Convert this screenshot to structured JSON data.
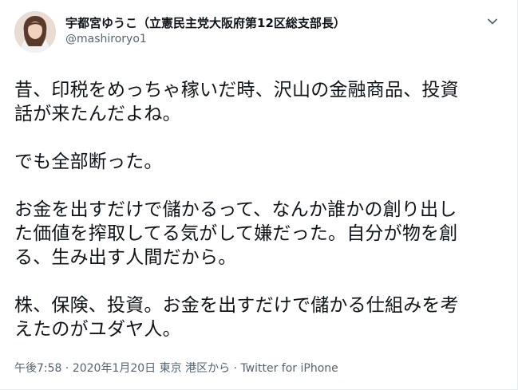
{
  "author": {
    "display_name": "宇都宮ゆうこ（立憲民主党大阪府第12区総支部長）",
    "handle": "@mashiroryo1"
  },
  "icons": {
    "avatar": "profile-photo",
    "more": "more-icon"
  },
  "tweet": {
    "lines": [
      "昔、印税をめっちゃ稼いだ時、沢山の金融商品、投資",
      "話が来たんだよね。",
      "",
      "でも全部断った。",
      "",
      "お金を出すだけで儲かるって、なんか誰かの創り出し",
      "た価値を搾取してる気がして嫌だった。自分が物を創",
      "る、生み出す人間だから。",
      "",
      "株、保険、投資。お金を出すだけで儲かる仕組みを考",
      "えたのがユダヤ人。"
    ]
  },
  "meta": {
    "time": "午後7:58",
    "sep1": " · ",
    "date": "2020年1月20日",
    "location": " 東京 港区から",
    "sep2": " · ",
    "source": "Twitter for iPhone"
  },
  "colors": {
    "text": "#0f1419",
    "secondary": "#536471",
    "border": "#e6ecf0"
  }
}
